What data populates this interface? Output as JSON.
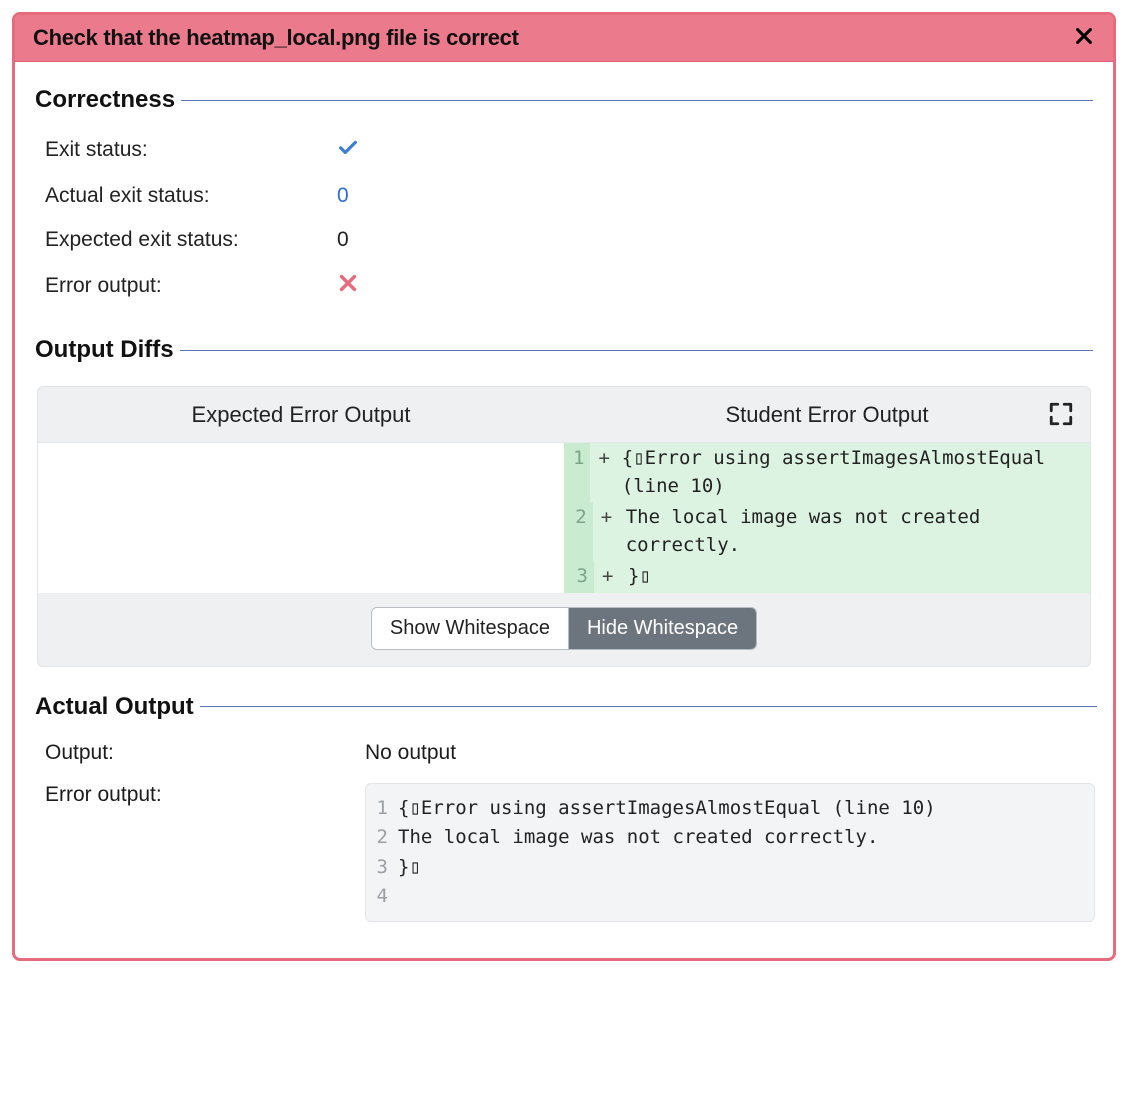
{
  "header": {
    "title": "Check that the heatmap_local.png file is correct"
  },
  "sections": {
    "correctness": {
      "legend": "Correctness",
      "rows": {
        "exit_status": {
          "label": "Exit status:",
          "icon": "check"
        },
        "actual_exit": {
          "label": "Actual exit status:",
          "value": "0"
        },
        "expected_exit": {
          "label": "Expected exit status:",
          "value": "0"
        },
        "error_output": {
          "label": "Error output:",
          "icon": "x"
        }
      }
    },
    "diffs": {
      "legend": "Output Diffs",
      "left_header": "Expected Error Output",
      "right_header": "Student Error Output",
      "right_lines": [
        {
          "n": "1",
          "mark": "+",
          "text": "{▯Error using assertImagesAlmostEqual (line 10)"
        },
        {
          "n": "2",
          "mark": "+",
          "text": "The local image was not created correctly."
        },
        {
          "n": "3",
          "mark": "+",
          "text": "}▯"
        }
      ],
      "buttons": {
        "show": "Show Whitespace",
        "hide": "Hide Whitespace"
      }
    },
    "actual": {
      "legend": "Actual Output",
      "output_label": "Output:",
      "output_value": "No output",
      "error_label": "Error output:",
      "error_lines": [
        {
          "n": "1",
          "text": "{▯Error using assertImagesAlmostEqual (line 10)"
        },
        {
          "n": "2",
          "text": "The local image was not created correctly."
        },
        {
          "n": "3",
          "text": "}▯"
        },
        {
          "n": "4",
          "text": ""
        }
      ]
    }
  }
}
